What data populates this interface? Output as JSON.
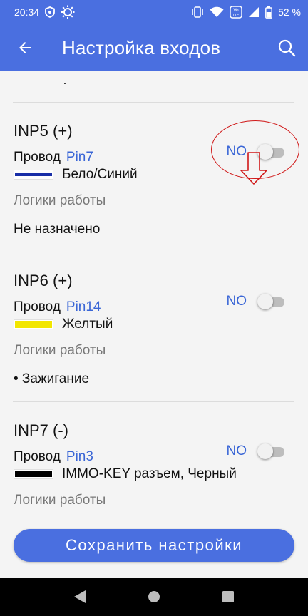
{
  "status_bar": {
    "time": "20:34",
    "battery": "52 %",
    "volte_label": "Vo LTE",
    "icons": [
      "shield-icon",
      "brightness-icon",
      "vibrate-icon",
      "wifi-icon",
      "signal-icon",
      "battery-icon"
    ]
  },
  "app_bar": {
    "title": "Настройка входов",
    "back_icon": "arrow-back-icon",
    "search_icon": "search-icon"
  },
  "top_partial_text": "·",
  "inputs": [
    {
      "name": "INP5 (+)",
      "wire_label": "Провод",
      "pin": "Pin7",
      "wire_color_name": "Бело/Синий",
      "swatch_color": "#1a2fa8",
      "logic_label": "Логики работы",
      "logic_value": "Не назначено",
      "mode": "NO",
      "enabled": false
    },
    {
      "name": "INP6 (+)",
      "wire_label": "Провод",
      "pin": "Pin14",
      "wire_color_name": "Желтый",
      "swatch_color": "#f2e600",
      "logic_label": "Логики работы",
      "logic_value": "• Зажигание",
      "mode": "NO",
      "enabled": false
    },
    {
      "name": "INP7 (-)",
      "wire_label": "Провод",
      "pin": "Pin3",
      "wire_color_name": "IMMO-KEY разъем, Черный",
      "swatch_color": "#000000",
      "logic_label": "Логики работы",
      "mode": "NO",
      "enabled": false
    }
  ],
  "save_button": "Сохранить настройки",
  "nav_bar": {
    "icons": [
      "back-triangle-icon",
      "home-circle-icon",
      "recents-square-icon"
    ]
  },
  "colors": {
    "primary": "#4a6fe0",
    "link": "#3a66d6",
    "annotation": "#d01818"
  }
}
